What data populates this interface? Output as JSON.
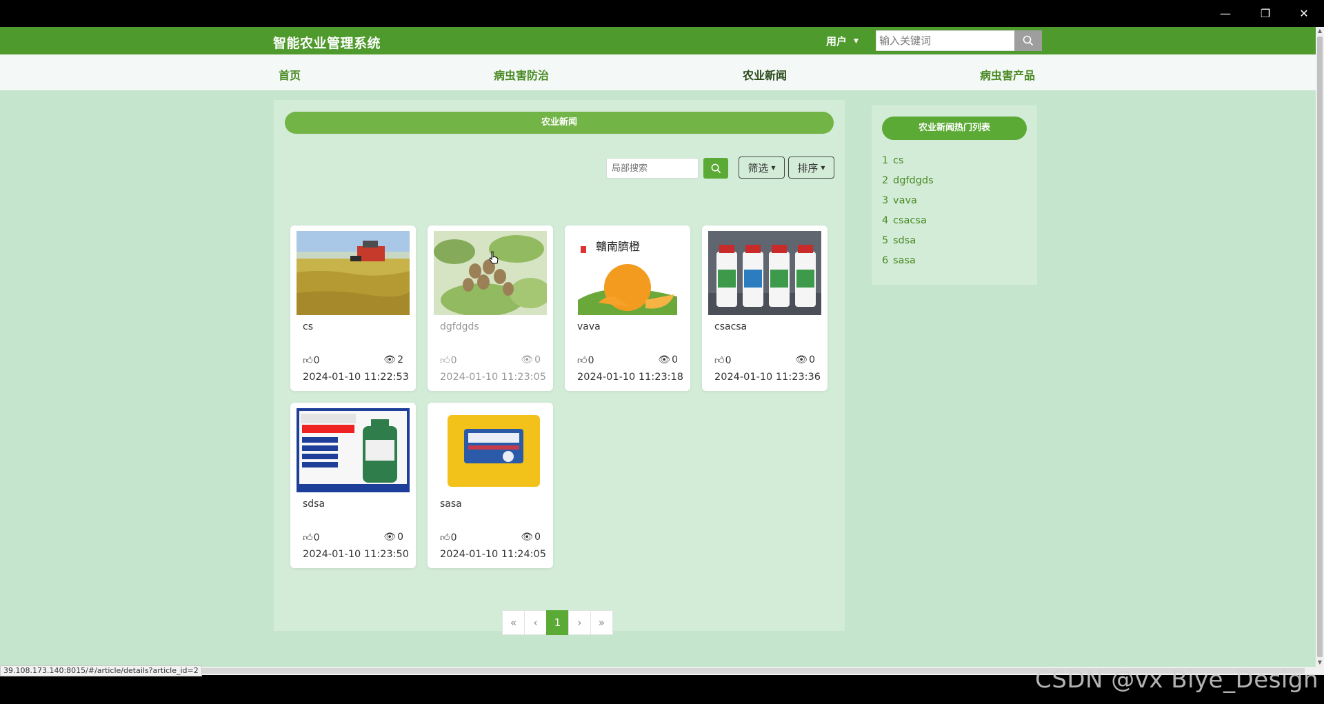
{
  "window": {
    "controls": {
      "minimize": "—",
      "restore": "❐",
      "close": "✕"
    }
  },
  "header": {
    "title": "智能农业管理系统",
    "user_label": "用户",
    "search_placeholder": "输入关键词"
  },
  "nav": {
    "items": [
      {
        "label": "首页",
        "active": false
      },
      {
        "label": "病虫害防治",
        "active": false
      },
      {
        "label": "农业新闻",
        "active": true
      },
      {
        "label": "病虫害产品",
        "active": false
      }
    ]
  },
  "main": {
    "section_title": "农业新闻",
    "local_search_placeholder": "局部搜索",
    "filter_label": "筛选",
    "sort_label": "排序",
    "articles": [
      {
        "name": "cs",
        "likes": "0",
        "views": "2",
        "date": "2024-01-10 11:22:53",
        "image": "rice-harvester"
      },
      {
        "name": "dgfdgds",
        "likes": "0",
        "views": "0",
        "date": "2024-01-10 11:23:05",
        "image": "kiwi-fruit"
      },
      {
        "name": "vava",
        "likes": "0",
        "views": "0",
        "date": "2024-01-10 11:23:18",
        "image": "navel-orange"
      },
      {
        "name": "csacsa",
        "likes": "0",
        "views": "0",
        "date": "2024-01-10 11:23:36",
        "image": "pesticide-bottles"
      },
      {
        "name": "sdsa",
        "likes": "0",
        "views": "0",
        "date": "2024-01-10 11:23:50",
        "image": "insecticide-ad"
      },
      {
        "name": "sasa",
        "likes": "0",
        "views": "0",
        "date": "2024-01-10 11:24:05",
        "image": "fertilizer-bag"
      }
    ],
    "pagination": {
      "first": "«",
      "prev": "‹",
      "current": "1",
      "next": "›",
      "last": "»"
    }
  },
  "hot_list": {
    "title": "农业新闻热门列表",
    "items": [
      {
        "rank": "1",
        "name": "cs"
      },
      {
        "rank": "2",
        "name": "dgfdgds"
      },
      {
        "rank": "3",
        "name": "vava"
      },
      {
        "rank": "4",
        "name": "csacsa"
      },
      {
        "rank": "5",
        "name": "sdsa"
      },
      {
        "rank": "6",
        "name": "sasa"
      }
    ]
  },
  "status_url": "39.108.173.140:8015/#/article/details?article_id=2",
  "watermark": "CSDN @vx Biye_Design",
  "colors": {
    "header_green": "#4f9a2c",
    "accent_green": "#5aaa35",
    "page_bg": "#c5e5cd",
    "panel_bg": "#d3ecd8"
  }
}
